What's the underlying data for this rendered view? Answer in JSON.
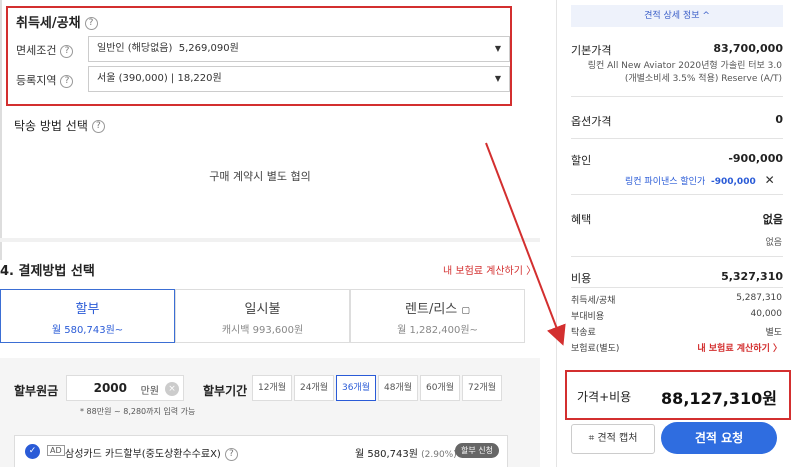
{
  "tax": {
    "title": "취득세/공채",
    "exemption_label": "면세조건",
    "exemption_value": "일반인 (해당없음)",
    "exemption_amount": "5,269,090원",
    "region_label": "등록지역",
    "region_value": "서울 (390,000)",
    "region_amount": "18,220원"
  },
  "delivery": {
    "title": "탁송 방법 선택",
    "note": "구매 계약시 별도 협의"
  },
  "payment": {
    "title": "4. 결제방법 선택",
    "insurance_link": "내 보험료 계산하기 〉",
    "tabs": [
      {
        "label": "할부",
        "sub": "월 580,743원~"
      },
      {
        "label": "일시불",
        "sub": "캐시백 993,600원"
      },
      {
        "label": "렌트/리스",
        "sub": "월 1,282,400원~"
      }
    ],
    "principal_label": "할부원금",
    "principal_value": "2000",
    "principal_unit": "만원",
    "principal_hint": "* 88만원 ~ 8,280까지 입력 가능",
    "period_label": "할부기간",
    "months": [
      "12개월",
      "24개월",
      "36개월",
      "48개월",
      "60개월",
      "72개월"
    ],
    "selected_month": "36개월",
    "card": {
      "ad": "AD",
      "name": "삼성카드 카드할부(중도상환수수료X)",
      "amount": "월 580,743원",
      "rate": "(2.90%)",
      "apply": "할부 신청"
    }
  },
  "summary": {
    "detail_toggle": "견적 상세 정보 ^",
    "base_price_label": "기본가격",
    "base_price": "83,700,000",
    "base_desc": "링컨 All New Aviator 2020년형 가솔린 터보 3.0 (개별소비세 3.5% 적용) Reserve (A/T)",
    "option_label": "옵션가격",
    "option_price": "0",
    "discount_label": "할인",
    "discount_price": "-900,000",
    "discount_item": "링컨 파이낸스 할인가",
    "discount_item_price": "-900,000",
    "benefit_label": "혜택",
    "benefit_value": "없음",
    "benefit_sub": "없음",
    "cost_label": "비용",
    "cost_value": "5,327,310",
    "costs": [
      {
        "k": "취득세/공채",
        "v": "5,287,310"
      },
      {
        "k": "부대비용",
        "v": "40,000"
      },
      {
        "k": "탁송료",
        "v": "별도"
      },
      {
        "k": "보험료(별도)",
        "v": "내 보험료 계산하기 〉"
      }
    ],
    "total_label": "가격+비용",
    "total_value": "88,127,310원",
    "capture_label": "견적 캡처",
    "quote_label": "견적 요청"
  }
}
